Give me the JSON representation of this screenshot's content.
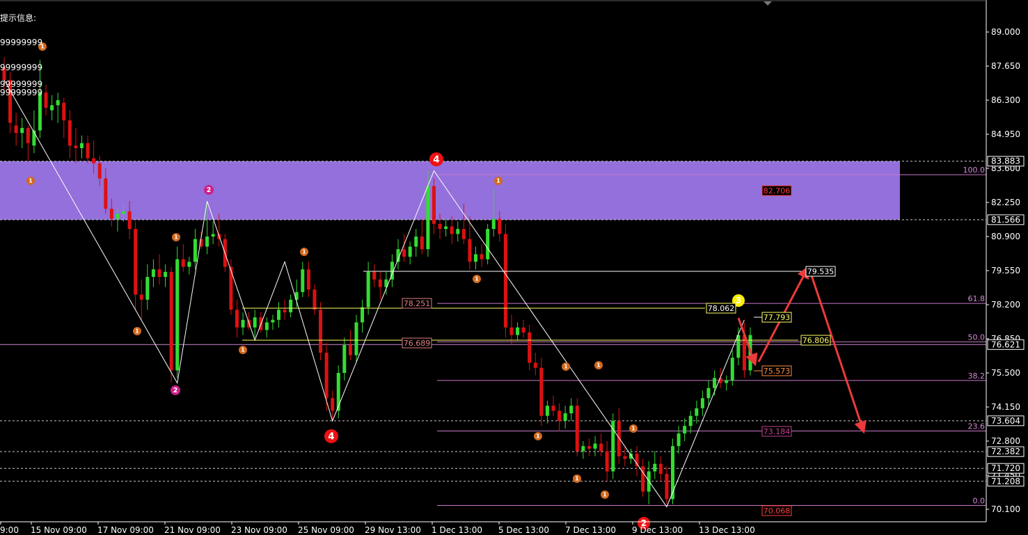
{
  "info": {
    "header": "提示信息:",
    "lines": [
      "99999999",
      "99999999",
      "99999999",
      "99999999"
    ]
  },
  "chart_data": {
    "type": "candlestick",
    "price_axis": {
      "ticks": [
        "89.000",
        "87.650",
        "86.300",
        "84.950",
        "83.600",
        "82.250",
        "80.900",
        "79.550",
        "78.200",
        "76.850",
        "75.500",
        "74.150",
        "72.800",
        "71.450",
        "70.100"
      ],
      "range": [
        69.6,
        90.0
      ]
    },
    "time_axis": {
      "labels": [
        "9:00",
        "15 Nov 09:00",
        "17 Nov 09:00",
        "21 Nov 09:00",
        "23 Nov 09:00",
        "25 Nov 09:00",
        "29 Nov 13:00",
        "1 Dec 13:00",
        "5 Dec 13:00",
        "7 Dec 13:00",
        "9 Dec 13:00",
        "13 Dec 13:00"
      ]
    },
    "zone": {
      "top": 83.883,
      "bottom": 81.566,
      "color": "#9370db"
    },
    "horizontal_levels": [
      {
        "price": 83.883,
        "label": "83.883",
        "style": "dashed",
        "color": "#cccccc"
      },
      {
        "price": 81.566,
        "label": "81.566",
        "style": "dashed",
        "color": "#cccccc"
      },
      {
        "price": 76.621,
        "label": "76.621",
        "style": "solid",
        "color": "#cc88cc"
      },
      {
        "price": 73.604,
        "label": "73.604",
        "style": "dashed",
        "color": "#cccccc"
      },
      {
        "price": 72.382,
        "label": "72.382",
        "style": "dashed",
        "color": "#cccccc"
      },
      {
        "price": 71.72,
        "label": "71.720",
        "style": "dashed",
        "color": "#cccccc"
      },
      {
        "price": 71.208,
        "label": "71.208",
        "style": "dashed",
        "color": "#cccccc"
      }
    ],
    "fibonacci": [
      {
        "level": "100.0",
        "price": 83.35
      },
      {
        "level": "61.8",
        "price": 78.25
      },
      {
        "level": "50.0",
        "price": 76.73
      },
      {
        "level": "38.2",
        "price": 75.2
      },
      {
        "level": "23.6",
        "price": 73.2
      },
      {
        "level": "0.0",
        "price": 70.25
      }
    ],
    "price_labels": [
      {
        "text": "82.706",
        "color": "#ff3b3b",
        "border": "#ff3b3b"
      },
      {
        "text": "79.535",
        "color": "#ffffff",
        "border": "#ffffff"
      },
      {
        "text": "78.251",
        "color": "#e08080",
        "border": "#e08080"
      },
      {
        "text": "78.062",
        "color": "#ffffff",
        "border": "#ffff66"
      },
      {
        "text": "77.793",
        "color": "#ffff66",
        "border": "#ffff66"
      },
      {
        "text": "76.689",
        "color": "#e08080",
        "border": "#e08080"
      },
      {
        "text": "76.806",
        "color": "#ffff66",
        "border": "#ffff66"
      },
      {
        "text": "75.573",
        "color": "#ff8c42",
        "border": "#ff8c42"
      },
      {
        "text": "73.184",
        "color": "#c04090",
        "border": "#c04090"
      },
      {
        "text": "70.068",
        "color": "#ff3b3b",
        "border": "#ff3b3b"
      }
    ],
    "wave_labels": [
      "1",
      "2",
      "3",
      "4"
    ],
    "zigzag": [
      87.1,
      75.1,
      82.3,
      76.8,
      79.9,
      73.6,
      83.5,
      70.2,
      77.6
    ],
    "bull_color": "#33dd33",
    "bear_color": "#dd1111",
    "candles": [
      [
        87.6,
        88.0,
        86.7,
        87.1
      ],
      [
        87.1,
        87.4,
        85.0,
        85.4
      ],
      [
        85.3,
        85.8,
        84.5,
        85.0
      ],
      [
        85.0,
        85.6,
        84.4,
        85.2
      ],
      [
        85.2,
        85.3,
        83.9,
        84.6
      ],
      [
        84.5,
        85.9,
        84.2,
        85.1
      ],
      [
        85.1,
        87.9,
        84.8,
        86.6
      ],
      [
        86.6,
        86.9,
        85.7,
        86.0
      ],
      [
        85.9,
        86.5,
        85.5,
        86.1
      ],
      [
        86.1,
        86.6,
        85.4,
        86.3
      ],
      [
        86.2,
        86.4,
        84.8,
        85.5
      ],
      [
        85.5,
        85.9,
        84.0,
        84.5
      ],
      [
        84.5,
        85.2,
        83.8,
        84.4
      ],
      [
        84.4,
        84.9,
        84.0,
        84.6
      ],
      [
        84.6,
        84.9,
        83.8,
        84.0
      ],
      [
        84.0,
        84.7,
        83.4,
        83.8
      ],
      [
        83.8,
        84.1,
        82.9,
        83.2
      ],
      [
        83.2,
        83.6,
        81.8,
        82.0
      ],
      [
        82.0,
        82.4,
        81.3,
        81.6
      ],
      [
        81.6,
        82.0,
        81.1,
        81.8
      ],
      [
        81.8,
        82.2,
        81.5,
        81.9
      ],
      [
        81.9,
        82.3,
        80.8,
        81.2
      ],
      [
        81.2,
        81.5,
        78.0,
        78.6
      ],
      [
        78.6,
        79.2,
        77.6,
        78.4
      ],
      [
        78.4,
        79.8,
        78.0,
        79.3
      ],
      [
        79.3,
        80.0,
        78.9,
        79.6
      ],
      [
        79.6,
        80.2,
        79.0,
        79.3
      ],
      [
        79.3,
        79.8,
        78.9,
        79.5
      ],
      [
        79.5,
        79.7,
        75.1,
        75.6
      ],
      [
        75.6,
        80.5,
        75.3,
        80.0
      ],
      [
        80.0,
        80.6,
        79.5,
        79.7
      ],
      [
        79.7,
        80.1,
        79.4,
        79.9
      ],
      [
        79.9,
        81.2,
        79.6,
        80.8
      ],
      [
        80.8,
        81.1,
        80.4,
        80.5
      ],
      [
        80.5,
        82.3,
        80.2,
        80.9
      ],
      [
        80.9,
        81.5,
        80.6,
        81.0
      ],
      [
        81.0,
        81.8,
        80.5,
        80.8
      ],
      [
        80.8,
        81.0,
        79.5,
        79.7
      ],
      [
        79.7,
        80.0,
        77.8,
        78.0
      ],
      [
        78.0,
        78.4,
        76.9,
        77.3
      ],
      [
        77.3,
        77.9,
        77.0,
        77.6
      ],
      [
        77.6,
        77.9,
        77.2,
        77.3
      ],
      [
        77.3,
        78.0,
        76.9,
        77.7
      ],
      [
        77.7,
        77.9,
        77.1,
        77.2
      ],
      [
        77.2,
        77.7,
        76.9,
        77.5
      ],
      [
        77.5,
        77.8,
        77.2,
        77.6
      ],
      [
        77.6,
        78.3,
        77.3,
        78.0
      ],
      [
        78.0,
        78.4,
        77.6,
        77.9
      ],
      [
        77.9,
        78.6,
        77.7,
        78.4
      ],
      [
        78.4,
        79.2,
        78.1,
        78.7
      ],
      [
        78.7,
        79.9,
        78.5,
        79.6
      ],
      [
        79.6,
        79.9,
        78.5,
        78.8
      ],
      [
        78.8,
        79.0,
        77.8,
        78.0
      ],
      [
        78.0,
        78.3,
        76.0,
        76.3
      ],
      [
        76.3,
        76.7,
        74.0,
        74.5
      ],
      [
        74.5,
        74.8,
        73.6,
        74.0
      ],
      [
        74.0,
        75.8,
        73.7,
        75.5
      ],
      [
        75.5,
        76.9,
        75.2,
        76.6
      ],
      [
        76.6,
        77.2,
        76.0,
        76.2
      ],
      [
        76.2,
        77.8,
        75.9,
        77.5
      ],
      [
        77.5,
        78.4,
        77.1,
        78.1
      ],
      [
        78.1,
        79.9,
        77.8,
        79.5
      ],
      [
        79.5,
        79.8,
        78.9,
        79.2
      ],
      [
        79.2,
        79.5,
        78.4,
        78.9
      ],
      [
        78.9,
        79.5,
        78.6,
        79.2
      ],
      [
        79.2,
        80.2,
        78.9,
        79.9
      ],
      [
        79.9,
        80.8,
        79.6,
        80.4
      ],
      [
        80.4,
        81.0,
        79.9,
        80.1
      ],
      [
        80.1,
        80.7,
        79.8,
        80.5
      ],
      [
        80.5,
        81.2,
        80.1,
        80.9
      ],
      [
        80.9,
        81.6,
        80.2,
        80.4
      ],
      [
        80.4,
        83.5,
        80.1,
        82.9
      ],
      [
        82.9,
        83.2,
        81.0,
        81.4
      ],
      [
        81.4,
        81.8,
        80.8,
        81.2
      ],
      [
        81.2,
        81.6,
        80.9,
        81.3
      ],
      [
        81.3,
        81.7,
        80.6,
        81.0
      ],
      [
        81.0,
        81.5,
        80.7,
        81.2
      ],
      [
        81.2,
        82.2,
        80.6,
        80.8
      ],
      [
        80.8,
        81.7,
        79.6,
        79.9
      ],
      [
        79.9,
        80.5,
        79.6,
        80.2
      ],
      [
        80.2,
        80.6,
        79.7,
        80.0
      ],
      [
        80.0,
        81.4,
        79.8,
        81.2
      ],
      [
        81.2,
        82.8,
        80.9,
        81.6
      ],
      [
        81.6,
        81.9,
        80.7,
        81.0
      ],
      [
        81.0,
        81.4,
        76.9,
        77.3
      ],
      [
        77.3,
        77.8,
        76.6,
        77.0
      ],
      [
        77.0,
        77.5,
        76.8,
        77.3
      ],
      [
        77.3,
        77.6,
        76.9,
        77.1
      ],
      [
        77.1,
        77.4,
        75.6,
        75.9
      ],
      [
        75.9,
        76.3,
        75.4,
        75.7
      ],
      [
        75.7,
        76.1,
        73.4,
        73.8
      ],
      [
        73.8,
        74.4,
        73.5,
        74.2
      ],
      [
        74.2,
        74.6,
        73.8,
        74.0
      ],
      [
        74.0,
        74.3,
        73.2,
        73.6
      ],
      [
        73.6,
        74.2,
        73.3,
        73.9
      ],
      [
        73.9,
        74.5,
        73.6,
        74.2
      ],
      [
        74.2,
        74.5,
        72.2,
        72.4
      ],
      [
        72.4,
        72.8,
        72.1,
        72.6
      ],
      [
        72.6,
        72.9,
        72.2,
        72.5
      ],
      [
        72.5,
        73.0,
        72.2,
        72.7
      ],
      [
        72.7,
        73.1,
        72.2,
        72.4
      ],
      [
        72.4,
        72.8,
        71.2,
        71.6
      ],
      [
        71.6,
        73.9,
        71.3,
        73.6
      ],
      [
        73.6,
        74.1,
        71.9,
        72.2
      ],
      [
        72.2,
        72.6,
        71.8,
        72.1
      ],
      [
        72.1,
        72.5,
        71.9,
        72.3
      ],
      [
        72.3,
        72.6,
        71.4,
        71.8
      ],
      [
        71.8,
        72.1,
        70.6,
        70.8
      ],
      [
        70.8,
        72.0,
        70.3,
        71.6
      ],
      [
        71.6,
        72.4,
        71.3,
        71.9
      ],
      [
        71.9,
        72.2,
        71.2,
        71.5
      ],
      [
        71.5,
        71.8,
        70.3,
        70.5
      ],
      [
        70.5,
        72.9,
        70.3,
        72.6
      ],
      [
        72.6,
        73.4,
        72.3,
        73.1
      ],
      [
        73.1,
        73.7,
        72.8,
        73.4
      ],
      [
        73.4,
        74.0,
        73.1,
        73.8
      ],
      [
        73.8,
        74.4,
        73.5,
        74.1
      ],
      [
        74.1,
        74.8,
        73.8,
        74.5
      ],
      [
        74.5,
        75.2,
        74.2,
        74.9
      ],
      [
        74.9,
        75.6,
        74.6,
        75.3
      ],
      [
        75.3,
        75.7,
        74.9,
        75.1
      ],
      [
        75.1,
        75.4,
        74.8,
        75.2
      ],
      [
        75.2,
        76.4,
        75.0,
        76.1
      ],
      [
        76.1,
        77.3,
        75.8,
        77.0
      ],
      [
        77.0,
        77.5,
        75.3,
        75.6
      ],
      [
        75.6,
        77.3,
        75.4,
        77.0
      ]
    ]
  }
}
